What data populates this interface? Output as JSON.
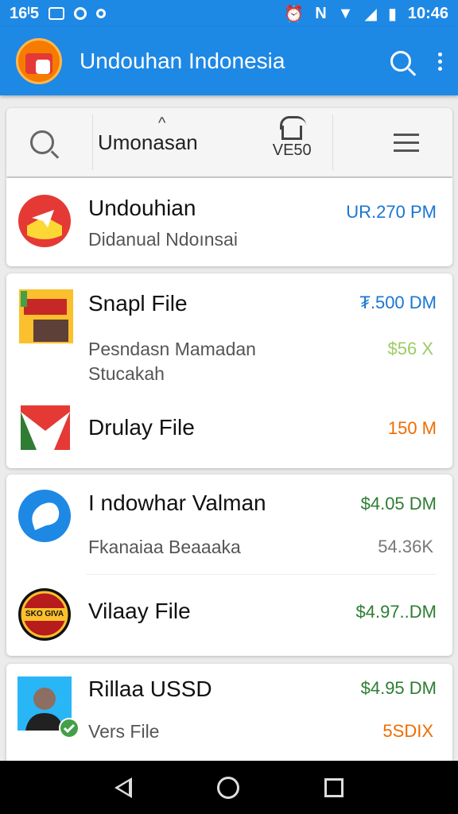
{
  "status_bar": {
    "left_text": "16ᴵ5",
    "time": "10:46"
  },
  "app_bar": {
    "title": "Undouhan Indonesia"
  },
  "toolbar": {
    "label": "Umonasan",
    "right_label": "VE50"
  },
  "items": [
    {
      "title": "Undouhian",
      "subtitle": "Didanual Ndoınsai",
      "value": "UR.270 PM",
      "value_color": "#1976d2"
    },
    {
      "title": "Snapl File",
      "subtitle": "Pesndasn Mamadan Stucakah",
      "value": "₮.500 DM",
      "value_color": "#1976d2",
      "value2": "$56 X",
      "value2_color": "#9ccc65"
    },
    {
      "title": "Drulay File",
      "value": "150 M",
      "value_color": "#ef6c00"
    },
    {
      "title": "I ndowhar Valman",
      "subtitle": "Fkanaiaa Beaaaka",
      "value": "$4.05 DM",
      "value_color": "#2e7d32",
      "value2": "54.36K",
      "value2_color": "#777777"
    },
    {
      "title": "Vilaay File",
      "value": "$4.97..DM",
      "value_color": "#2e7d32",
      "badge_text": "SKO GIVA"
    },
    {
      "title": "Rillaa USSD",
      "subtitle": "Vers File",
      "value": "$4.95 DM",
      "value_color": "#2e7d32",
      "value2": "5SDIX",
      "value2_color": "#ef6c00"
    }
  ]
}
